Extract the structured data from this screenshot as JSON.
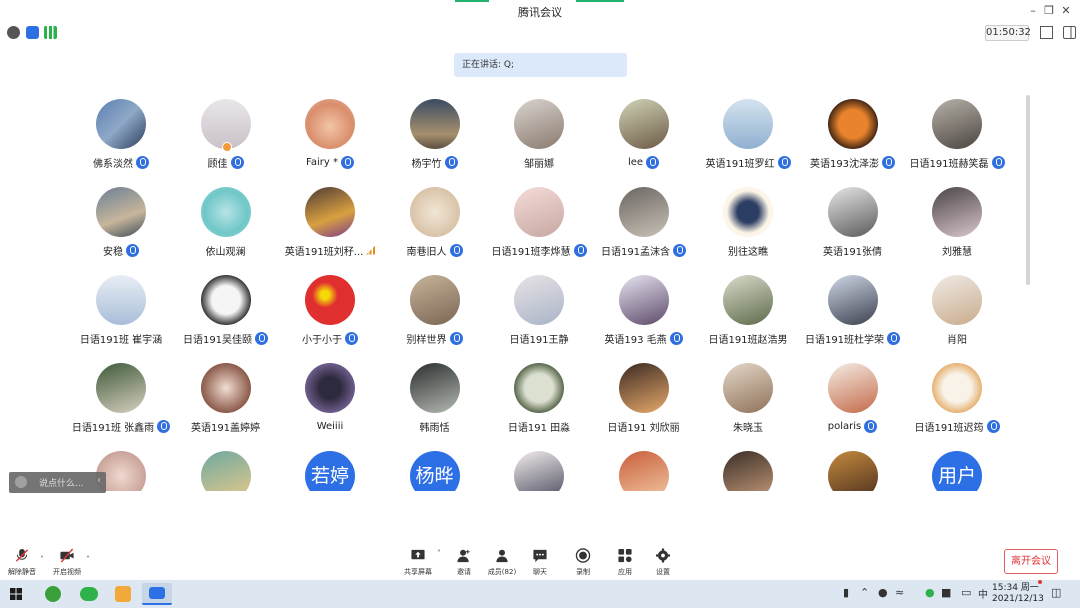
{
  "window": {
    "title": "腾讯会议"
  },
  "topbar": {
    "timer": "01:50:32"
  },
  "speaking": {
    "text": "正在讲话: Q;"
  },
  "participants": [
    {
      "name": "佛系淡然",
      "mic": true,
      "bg": "linear-gradient(135deg,#5a7fb0,#8fa8c8 50%,#2b3d5a)"
    },
    {
      "name": "顾佳",
      "mic": true,
      "bg": "linear-gradient(180deg,#e9e6ea,#c9c2c8)",
      "badge": true
    },
    {
      "name": "Fairy *",
      "mic": true,
      "bg": "radial-gradient(circle at 50% 55%,#f3c5a8,#d98e6c 60%,#e8b3a1)"
    },
    {
      "name": "杨宇竹",
      "mic": true,
      "bg": "linear-gradient(180deg,#3b4b63,#a6906e 70%,#5d5040)"
    },
    {
      "name": "邹丽娜",
      "mic": false,
      "bg": "linear-gradient(160deg,#d9d4cf,#8a7a6e)"
    },
    {
      "name": "lee",
      "mic": true,
      "bg": "linear-gradient(160deg,#cfd3b6,#6d5a45)"
    },
    {
      "name": "英语191班罗红",
      "mic": true,
      "bg": "linear-gradient(180deg,#d5e3ef,#8fb0d0)"
    },
    {
      "name": "英语193沈泽澎",
      "mic": true,
      "bg": "radial-gradient(circle,#e9842c 40%,#2d1a12 75%)"
    },
    {
      "name": "日语191班赫笑磊",
      "mic": true,
      "bg": "linear-gradient(160deg,#b7b2a8,#4b4540)"
    },
    {
      "name": "安稳",
      "mic": true,
      "bg": "linear-gradient(160deg,#6b7f95,#c7b69c 60%,#3d4a58)"
    },
    {
      "name": "依山观澜",
      "mic": false,
      "bg": "radial-gradient(circle,#b8e3e7,#6fc7c8 60%,#a2d8dc)"
    },
    {
      "name": "英语191班刘秄...",
      "mic": false,
      "signal": true,
      "bg": "linear-gradient(160deg,#4d3a35,#d9a040 60%,#7a3c8a)"
    },
    {
      "name": "南巷旧人",
      "mic": true,
      "bg": "radial-gradient(circle,#f2e6d6,#d9c3a8 70%)"
    },
    {
      "name": "日语191班李烨慧",
      "mic": true,
      "bg": "linear-gradient(160deg,#f4dcd8,#c7a7a2)"
    },
    {
      "name": "日语191孟沫含",
      "mic": true,
      "bg": "linear-gradient(160deg,#6b6662,#c9c1b6)"
    },
    {
      "name": "别往这瞧",
      "mic": false,
      "bg": "radial-gradient(circle,#2c3e63 30%,#fdf6e8 60%)"
    },
    {
      "name": "英语191张倩",
      "mic": false,
      "bg": "linear-gradient(160deg,#e6e6e6,#5b5b5b)"
    },
    {
      "name": "刘雅慧",
      "mic": false,
      "bg": "linear-gradient(160deg,#4a4448,#d9c6cb)"
    },
    {
      "name": "日语191班 崔宇涵",
      "mic": false,
      "bg": "linear-gradient(180deg,#e8eef5,#a9bdd8)"
    },
    {
      "name": "日语191吴佳颐",
      "mic": true,
      "bg": "radial-gradient(circle,#f5f5f5 40%,#3a3a3a 70%)"
    },
    {
      "name": "小于小于",
      "mic": true,
      "bg": "radial-gradient(circle at 40% 40%,#f5d90a 10%,#e02f2f 30%)"
    },
    {
      "name": "别样世界",
      "mic": true,
      "bg": "linear-gradient(160deg,#c8b39a,#7a6654)"
    },
    {
      "name": "日语191王静",
      "mic": false,
      "bg": "linear-gradient(160deg,#e9e3e6,#a8b4c8)"
    },
    {
      "name": "英语193 毛燕",
      "mic": true,
      "bg": "linear-gradient(160deg,#e8e4f0,#5c4a6a)"
    },
    {
      "name": "日语191班赵浩男",
      "mic": false,
      "bg": "linear-gradient(160deg,#d8dccb,#5e6a4a)"
    },
    {
      "name": "日语191班杜学荣",
      "mic": true,
      "bg": "linear-gradient(160deg,#cfd7e6,#3c4150)"
    },
    {
      "name": "肖阳",
      "mic": false,
      "bg": "linear-gradient(160deg,#f0ebe6,#c9ab8c)"
    },
    {
      "name": "日语191班 张鑫雨",
      "mic": true,
      "bg": "linear-gradient(160deg,#3e5a3a,#d8cfc1)"
    },
    {
      "name": "英语191盖婷婷",
      "mic": false,
      "bg": "radial-gradient(circle,#f1ded2,#8b5a4a 70%)"
    },
    {
      "name": "Weiiii",
      "mic": false,
      "bg": "radial-gradient(circle,#2e2a3d 30%,#6d5d8b 70%)"
    },
    {
      "name": "韩雨恬",
      "mic": false,
      "bg": "linear-gradient(160deg,#2a2f2e,#b5b9b3)"
    },
    {
      "name": "日语191 田淼",
      "mic": false,
      "bg": "radial-gradient(circle,#dce0d1 40%,#5b6a4e 70%)"
    },
    {
      "name": "日语191 刘欣丽",
      "mic": false,
      "bg": "linear-gradient(160deg,#3b2a22,#e7a96b)"
    },
    {
      "name": "朱晓玉",
      "mic": false,
      "bg": "linear-gradient(160deg,#e4d7c8,#8f7259)"
    },
    {
      "name": "polaris",
      "mic": true,
      "bg": "linear-gradient(160deg,#f4ede4,#c46a4a)"
    },
    {
      "name": "日语191班迟筠",
      "mic": true,
      "bg": "radial-gradient(circle,#f8f2e8 40%,#e6b374 70%)"
    },
    {
      "name": "",
      "mic": false,
      "bg": "radial-gradient(circle,#f0d8d0,#c9a39a 70%)"
    },
    {
      "name": "",
      "mic": false,
      "bg": "linear-gradient(160deg,#6ea9a0,#e8c98a)"
    },
    {
      "name": "",
      "mic": false,
      "bg": "#2d6fe5",
      "initial": "若婷"
    },
    {
      "name": "",
      "mic": false,
      "bg": "#2d6fe5",
      "initial": "杨晔"
    },
    {
      "name": "",
      "mic": false,
      "bg": "linear-gradient(160deg,#f3eef0,#4a4a5a)"
    },
    {
      "name": "",
      "mic": false,
      "bg": "linear-gradient(160deg,#c95e3c,#f2c9a3)"
    },
    {
      "name": "",
      "mic": false,
      "bg": "linear-gradient(160deg,#3a2e28,#c79c7a)"
    },
    {
      "name": "",
      "mic": false,
      "bg": "linear-gradient(160deg,#c48a3e,#4a2e1e)"
    },
    {
      "name": "",
      "mic": false,
      "bg": "#2d6fe5",
      "initial": "用户"
    }
  ],
  "chat": {
    "placeholder": "说点什么..."
  },
  "bottom_toolbar": {
    "left": [
      {
        "label": "解除静音",
        "icon": "mic-muted-icon"
      },
      {
        "label": "开启视频",
        "icon": "video-off-icon"
      }
    ],
    "center": [
      {
        "label": "共享屏幕",
        "icon": "share-screen-icon"
      },
      {
        "label": "邀请",
        "icon": "invite-icon"
      },
      {
        "label": "成员(82)",
        "icon": "members-icon"
      },
      {
        "label": "聊天",
        "icon": "chat-icon"
      },
      {
        "label": "录制",
        "icon": "record-icon"
      },
      {
        "label": "应用",
        "icon": "apps-icon"
      },
      {
        "label": "设置",
        "icon": "settings-icon"
      }
    ],
    "leave": "离开会议"
  },
  "taskbar": {
    "time": "15:34 周一",
    "date": "2021/12/13",
    "ime": "中"
  },
  "colors": {
    "accent_blue": "#2d6fe5",
    "leave_red": "#e03535",
    "taskbar_bg": "#dde7f1"
  }
}
